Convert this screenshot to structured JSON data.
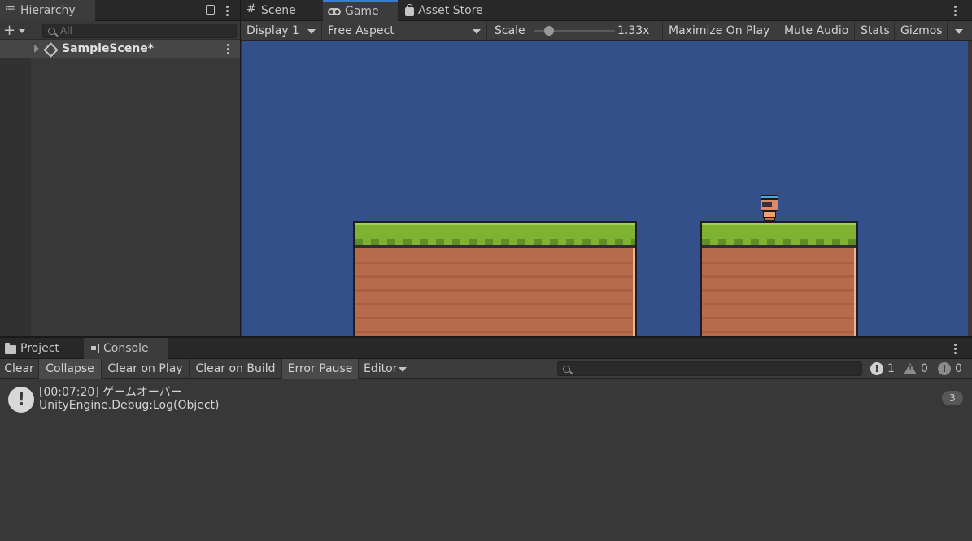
{
  "hierarchy": {
    "tab_label": "Hierarchy",
    "add_label": "+",
    "search_placeholder": "All",
    "scene_name": "SampleScene*"
  },
  "game": {
    "tabs": [
      {
        "label": "Scene",
        "icon": "hash-icon"
      },
      {
        "label": "Game",
        "icon": "gamepad-icon",
        "active": true
      },
      {
        "label": "Asset Store",
        "icon": "bag-icon"
      }
    ],
    "toolbar": {
      "display": "Display 1",
      "aspect": "Free Aspect",
      "scale_label": "Scale",
      "scale_value": "1.33x",
      "maximize": "Maximize On Play",
      "mute": "Mute Audio",
      "stats": "Stats",
      "gizmos": "Gizmos"
    },
    "sky_color": "#34508a"
  },
  "bottom": {
    "tabs": [
      {
        "label": "Project",
        "icon": "folder-icon"
      },
      {
        "label": "Console",
        "icon": "console-icon",
        "active": true
      }
    ],
    "toolbar": {
      "clear": "Clear",
      "collapse": "Collapse",
      "clear_on_play": "Clear on Play",
      "clear_on_build": "Clear on Build",
      "error_pause": "Error Pause",
      "editor": "Editor"
    },
    "counts": {
      "info": "1",
      "warn": "0",
      "error": "0"
    },
    "log": {
      "line1": "[00:07:20] ゲームオーバー",
      "line2": "UnityEngine.Debug:Log(Object)",
      "count": "3"
    }
  }
}
